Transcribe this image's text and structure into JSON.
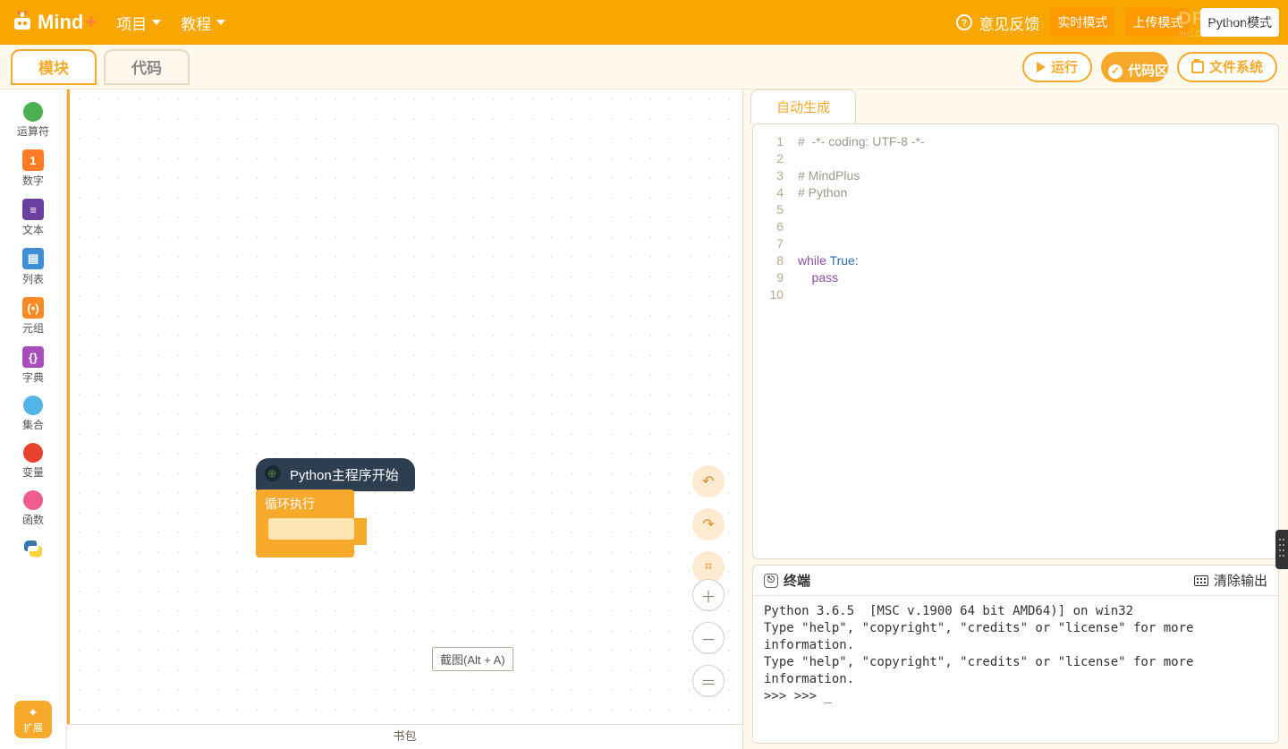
{
  "topbar": {
    "logo_text": "Mind",
    "logo_plus": "+",
    "menu_project": "项目",
    "menu_tutorial": "教程",
    "feedback": "意见反馈",
    "mode_live": "实时模式",
    "mode_upload": "上传模式",
    "mode_python": "Python模式",
    "watermark_title": "DF创客社区",
    "watermark_sub": "mc.DFRobot.com.cn"
  },
  "row2": {
    "tab_blocks": "模块",
    "tab_code": "代码",
    "run": "运行",
    "code_area": "代码区",
    "file_system": "文件系统"
  },
  "palette": [
    {
      "label": "运算符",
      "color": "#4CAF50",
      "shape": "dot",
      "name": "operators"
    },
    {
      "label": "数字",
      "color": "#FF7C24",
      "shape": "sq",
      "glyph": "1",
      "name": "number"
    },
    {
      "label": "文本",
      "color": "#6B3FA0",
      "shape": "sq",
      "glyph": "≡",
      "name": "text"
    },
    {
      "label": "列表",
      "color": "#3F8FD6",
      "shape": "sq",
      "glyph": "▤",
      "name": "list"
    },
    {
      "label": "元组",
      "color": "#FF8A24",
      "shape": "sq",
      "glyph": "(•)",
      "name": "tuple"
    },
    {
      "label": "字典",
      "color": "#A94DBE",
      "shape": "sq",
      "glyph": "{}",
      "name": "dict"
    },
    {
      "label": "集合",
      "color": "#52B4E8",
      "shape": "dot",
      "name": "set"
    },
    {
      "label": "变量",
      "color": "#E8412C",
      "shape": "dot",
      "name": "variable"
    },
    {
      "label": "函数",
      "color": "#F05C8F",
      "shape": "dot",
      "name": "function"
    },
    {
      "label": "",
      "color": "",
      "shape": "py",
      "name": "python"
    }
  ],
  "ext_label": "扩展",
  "blocks": {
    "start": "Python主程序开始",
    "loop": "循环执行"
  },
  "stage": {
    "hint": "截图(Alt + A)"
  },
  "code_tab": "自动生成",
  "code": {
    "lines": [
      "1",
      "2",
      "3",
      "4",
      "5",
      "6",
      "7",
      "8",
      "9",
      "10"
    ],
    "l1": "#  -*- coding: UTF-8 -*-",
    "l3": "# MindPlus",
    "l4": "# Python",
    "l8a": "while",
    "l8b": " True:",
    "l9": "    pass"
  },
  "terminal": {
    "title": "终端",
    "clear": "清除输出",
    "body": "Python 3.6.5  [MSC v.1900 64 bit AMD64)] on win32\nType \"help\", \"copyright\", \"credits\" or \"license\" for more information.\nType \"help\", \"copyright\", \"credits\" or \"license\" for more information.\n>>> >>> _"
  },
  "backpack": "书包"
}
